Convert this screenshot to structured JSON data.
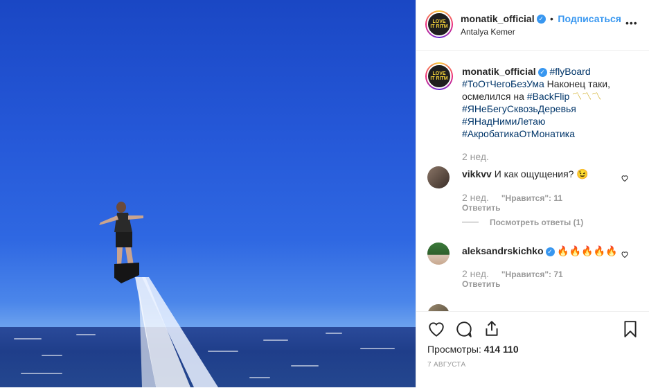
{
  "post": {
    "username": "monatik_official",
    "follow_label": "Подписаться",
    "location": "Antalya Kemer",
    "more_label": "•••",
    "avatar_text": "LOVE IT RITM",
    "dot": "•"
  },
  "caption": {
    "username": "monatik_official",
    "line1_tag": "#flyBoard",
    "line2_tag": "#ТоОтЧегоБезУма",
    "line2_text": " Наконец таки,",
    "line3_text": "осмелился на ",
    "line3_tag": "#BackFlip",
    "line3_emoji": " 〽〽〽",
    "line4_tag": "#ЯНеБегуСквозьДеревья",
    "line5_tag": "#ЯНадНимиЛетаю",
    "line6_tag": "#АкробатикаОтМонатика",
    "time": "2 нед."
  },
  "comments": [
    {
      "username": "vikkvv",
      "text": "И как ощущения? 😉",
      "time": "2 нед.",
      "likes": "\"Нравится\": 11",
      "reply": "Ответить",
      "view_replies": "Посмотреть ответы (1)"
    },
    {
      "username": "aleksandrskichko",
      "text": "🔥🔥🔥🔥🔥",
      "time": "2 нед.",
      "likes": "\"Нравится\": 71",
      "reply": "Ответить"
    }
  ],
  "stats": {
    "views_label": "Просмотры:",
    "views_value": "414 110",
    "date": "7 АВГУСТА"
  },
  "colors": {
    "accent": "#3897f0",
    "hashtag": "#003569",
    "text": "#262626",
    "muted": "#999999"
  },
  "icons": [
    "heart-icon",
    "comment-icon",
    "share-icon",
    "bookmark-icon",
    "more-icon",
    "verified-icon"
  ]
}
